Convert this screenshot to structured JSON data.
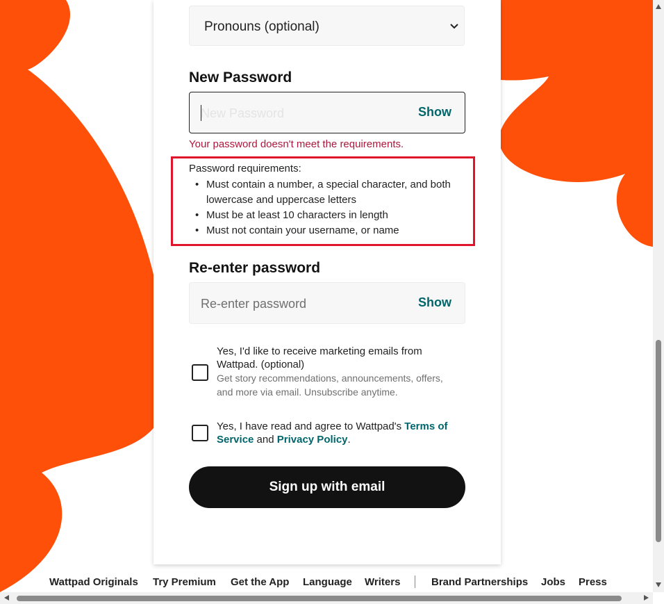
{
  "form": {
    "pronouns_value": "Pronouns (optional)",
    "new_password_label": "New Password",
    "new_password_placeholder": "New Password",
    "show_label": "Show",
    "error_text": "Your password doesn't meet the requirements.",
    "requirements_title": "Password requirements:",
    "requirements": [
      "Must contain a number, a special character, and both lowercase and uppercase letters",
      "Must be at least 10 characters in length",
      "Must not contain your username, or name"
    ],
    "reenter_label": "Re-enter password",
    "reenter_placeholder": "Re-enter password",
    "marketing_text": "Yes, I'd like to receive marketing emails from Wattpad. (optional)",
    "marketing_subtext": "Get story recommendations, announcements, offers, and more via email. Unsubscribe anytime.",
    "terms_prefix": "Yes, I have read and agree to Wattpad's ",
    "terms_link": "Terms of Service",
    "terms_and": " and ",
    "privacy_link": "Privacy Policy",
    "terms_suffix": ".",
    "signup_button": "Sign up with email"
  },
  "footer": {
    "links": [
      "Wattpad Originals",
      "Try Premium",
      "Get the App",
      "Language",
      "Writers",
      "Brand Partnerships",
      "Jobs",
      "Press"
    ]
  },
  "colors": {
    "brand_orange": "#ff500a",
    "link_teal": "#00666b",
    "error_red": "#b0163b",
    "highlight_red": "#e0142b"
  },
  "icons": {
    "dropdown": "chevron-down-icon"
  }
}
